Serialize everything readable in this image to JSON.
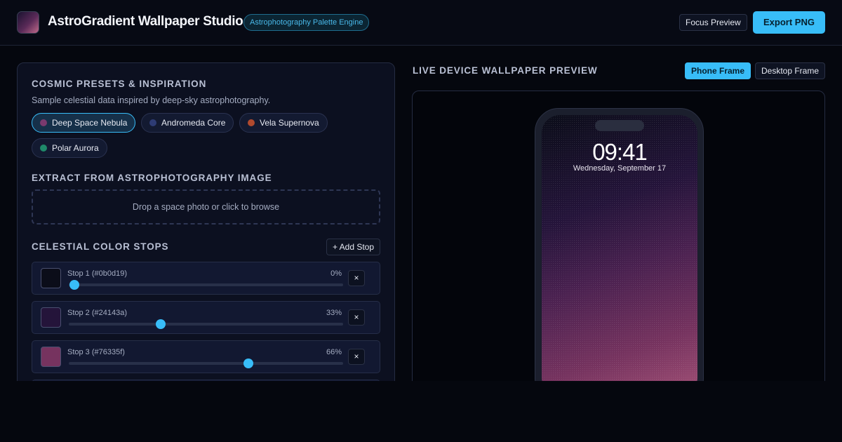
{
  "header": {
    "title": "AstroGradient Wallpaper Studio",
    "badge": "Astrophotography Palette Engine",
    "focus_label": "Focus Preview",
    "export_label": "Export PNG"
  },
  "presets": {
    "heading": "COSMIC PRESETS & INSPIRATION",
    "subtitle": "Sample celestial data inspired by deep-sky astrophotography.",
    "items": [
      {
        "label": "Deep Space Nebula",
        "color": "#7a3a6e",
        "active": true
      },
      {
        "label": "Andromeda Core",
        "color": "#2e3c75",
        "active": false
      },
      {
        "label": "Vela Supernova",
        "color": "#b04a2e",
        "active": false
      },
      {
        "label": "Polar Aurora",
        "color": "#1f8a6a",
        "active": false
      }
    ]
  },
  "extract": {
    "heading": "EXTRACT FROM ASTROPHOTOGRAPHY IMAGE",
    "dropzone": "Drop a space photo or click to browse"
  },
  "stops": {
    "heading": "CELESTIAL COLOR STOPS",
    "add_label": "+ Add Stop",
    "remove_label": "×",
    "items": [
      {
        "label": "Stop 1 (#0b0d19)",
        "color": "#0b0d19",
        "percent": "0%",
        "position": 0.02
      },
      {
        "label": "Stop 2 (#24143a)",
        "color": "#24143a",
        "percent": "33%",
        "position": 0.335
      },
      {
        "label": "Stop 3 (#76335f)",
        "color": "#76335f",
        "percent": "66%",
        "position": 0.655
      }
    ]
  },
  "preview": {
    "heading": "LIVE DEVICE WALLPAPER PREVIEW",
    "phone_frame": "Phone Frame",
    "desktop_frame": "Desktop Frame",
    "time": "09:41",
    "date": "Wednesday, September 17"
  },
  "colors": {
    "accent": "#38bdf8",
    "background": "#05070e"
  }
}
